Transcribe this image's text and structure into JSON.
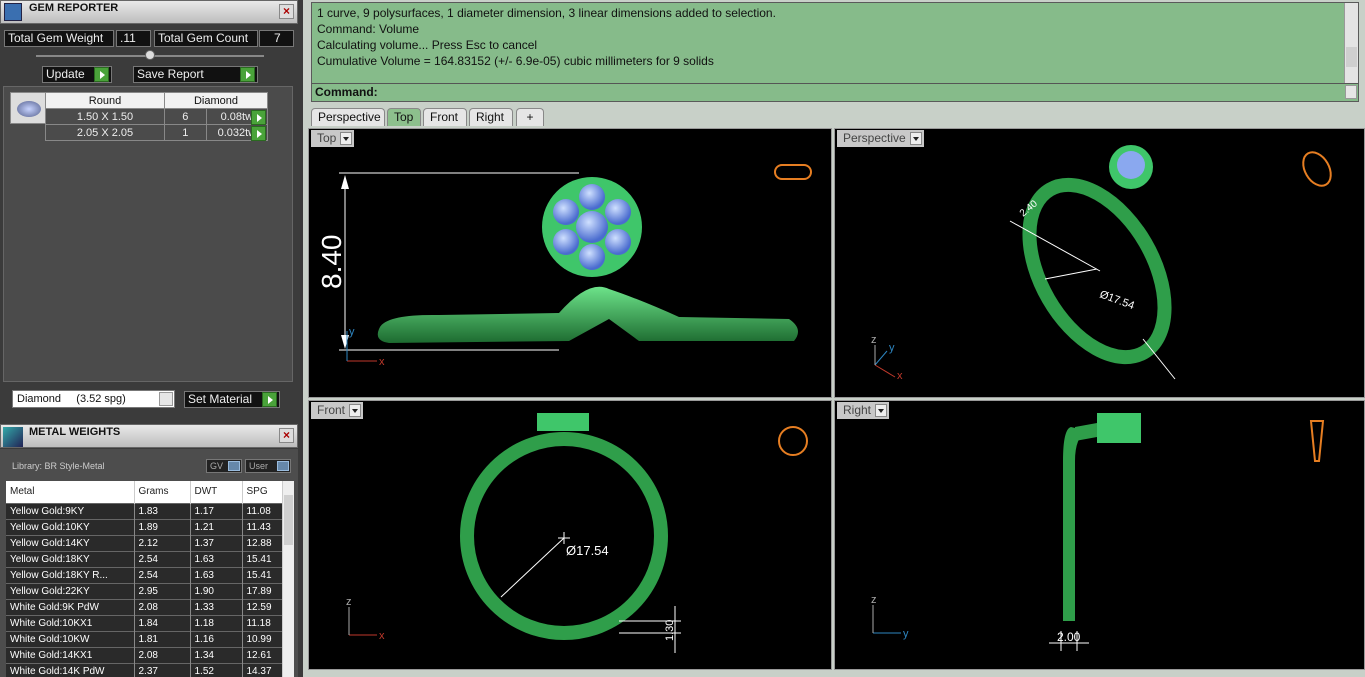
{
  "gem_reporter": {
    "title": "GEM REPORTER",
    "total_weight_label": "Total Gem Weight",
    "total_weight_value": ".11",
    "total_count_label": "Total Gem Count",
    "total_count_value": "7",
    "update_label": "Update",
    "save_report_label": "Save Report",
    "table_headers": [
      "Round",
      "Diamond"
    ],
    "rows": [
      {
        "size": "1.50 X 1.50",
        "count": "6",
        "weight": "0.08tw"
      },
      {
        "size": "2.05 X 2.05",
        "count": "1",
        "weight": "0.032tw"
      }
    ],
    "material_select": "Diamond     (3.52 spg)",
    "set_material_label": "Set Material"
  },
  "metal_weights": {
    "title": "METAL WEIGHTS",
    "library": "Library: BR Style-Metal",
    "gv_label": "GV",
    "user_label": "User",
    "headers": [
      "Metal",
      "Grams",
      "DWT",
      "SPG"
    ],
    "rows": [
      [
        "Yellow Gold:9KY",
        "1.83",
        "1.17",
        "11.08"
      ],
      [
        "Yellow Gold:10KY",
        "1.89",
        "1.21",
        "11.43"
      ],
      [
        "Yellow Gold:14KY",
        "2.12",
        "1.37",
        "12.88"
      ],
      [
        "Yellow Gold:18KY",
        "2.54",
        "1.63",
        "15.41"
      ],
      [
        "Yellow Gold:18KY R...",
        "2.54",
        "1.63",
        "15.41"
      ],
      [
        "Yellow Gold:22KY",
        "2.95",
        "1.90",
        "17.89"
      ],
      [
        "White Gold:9K PdW",
        "2.08",
        "1.33",
        "12.59"
      ],
      [
        "White Gold:10KX1",
        "1.84",
        "1.18",
        "11.18"
      ],
      [
        "White Gold:10KW",
        "1.81",
        "1.16",
        "10.99"
      ],
      [
        "White Gold:14KX1",
        "2.08",
        "1.34",
        "12.61"
      ],
      [
        "White Gold:14K PdW",
        "2.37",
        "1.52",
        "14.37"
      ]
    ]
  },
  "command": {
    "lines": [
      "1 curve, 9 polysurfaces, 1 diameter dimension, 3 linear dimensions added to selection.",
      "Command: Volume",
      "Calculating volume... Press Esc to cancel",
      "Cumulative Volume = 164.83152 (+/- 6.9e-05) cubic millimeters for 9 solids"
    ],
    "prompt": "Command:"
  },
  "tabs": [
    "Perspective",
    "Top",
    "Front",
    "Right",
    "+"
  ],
  "viewports": {
    "top": "Top",
    "perspective": "Perspective",
    "front": "Front",
    "right": "Right"
  },
  "dims": {
    "height": "8.40",
    "diameter": "Ø17.54",
    "persp_diam": "Ø17.54",
    "persp_dim": "2.40",
    "front_small": "1.30",
    "right_width": "2.00"
  },
  "axes": {
    "x": "x",
    "y": "y",
    "z": "z"
  }
}
